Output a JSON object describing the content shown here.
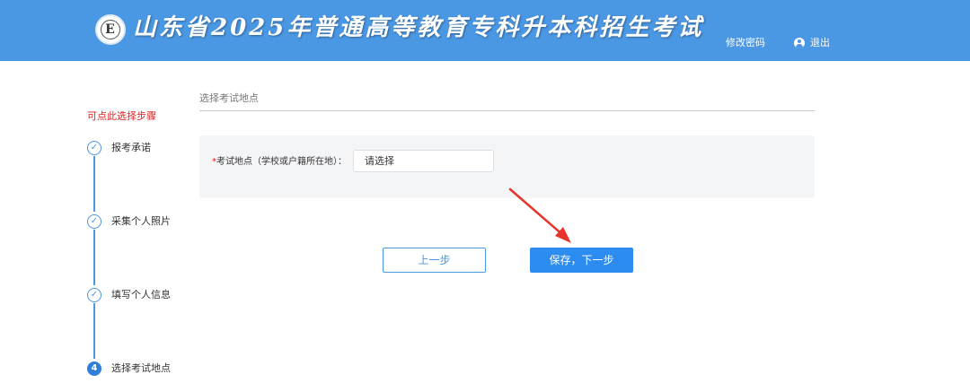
{
  "header": {
    "logo_icon": "university-seal-icon",
    "title": "山东省2025年普通高等教育专科升本科招生考试",
    "change_password": "修改密码",
    "logout": "退出",
    "bg_color": "#4a97e3"
  },
  "sidebar": {
    "hint": "可点此选择步骤",
    "steps": [
      {
        "label": "报考承诺",
        "status": "done",
        "icon": "check-circle-icon"
      },
      {
        "label": "采集个人照片",
        "status": "done",
        "icon": "check-circle-icon"
      },
      {
        "label": "填写个人信息",
        "status": "done",
        "icon": "check-circle-icon"
      },
      {
        "label": "选择考试地点",
        "status": "active",
        "number": "4"
      }
    ]
  },
  "main": {
    "section_title": "选择考试地点",
    "form": {
      "required_mark": "*",
      "field_label": "考试地点（学校或户籍所在地）：",
      "select_value": "请选择"
    },
    "buttons": {
      "prev": "上一步",
      "next": "保存，下一步"
    },
    "annotation": {
      "icon": "red-arrow-icon",
      "color": "#e8342a"
    }
  }
}
